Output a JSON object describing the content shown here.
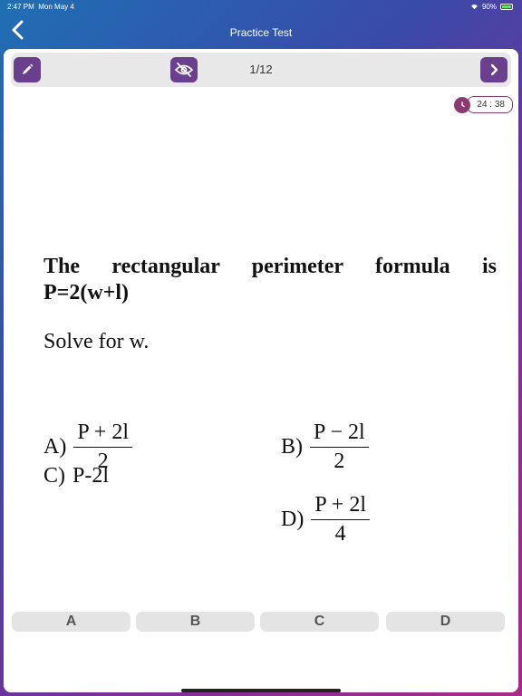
{
  "status_bar": {
    "time": "2:47 PM",
    "date": "Mon May 4",
    "battery": "90%",
    "wifi_icon": "wifi-icon",
    "battery_icon": "battery-icon"
  },
  "nav": {
    "title": "Practice Test",
    "back_icon": "chevron-left-icon"
  },
  "toolbar": {
    "edit_icon": "pencil-icon",
    "hide_icon": "eye-slash-icon",
    "page_indicator": "1/12",
    "next_icon": "chevron-right-icon"
  },
  "timer": {
    "icon": "clock-icon",
    "value": "24 : 38"
  },
  "question": {
    "stem_line1": "The rectangular perimeter formula is",
    "stem_line2": "P=2(w+l)",
    "instruction": "Solve for w.",
    "options": [
      {
        "letter": "A)",
        "numerator": "P + 2l",
        "denominator": "2"
      },
      {
        "letter": "B)",
        "numerator": "P − 2l",
        "denominator": "2"
      },
      {
        "letter": "C)",
        "text": "P-2l"
      },
      {
        "letter": "D)",
        "numerator": "P + 2l",
        "denominator": "4"
      }
    ]
  },
  "answers": [
    {
      "label": "A"
    },
    {
      "label": "B"
    },
    {
      "label": "C"
    },
    {
      "label": "D"
    }
  ],
  "colors": {
    "accent": "#6a3f8e",
    "timer": "#8a3a6e",
    "answer_button": "#e4e4e4"
  }
}
